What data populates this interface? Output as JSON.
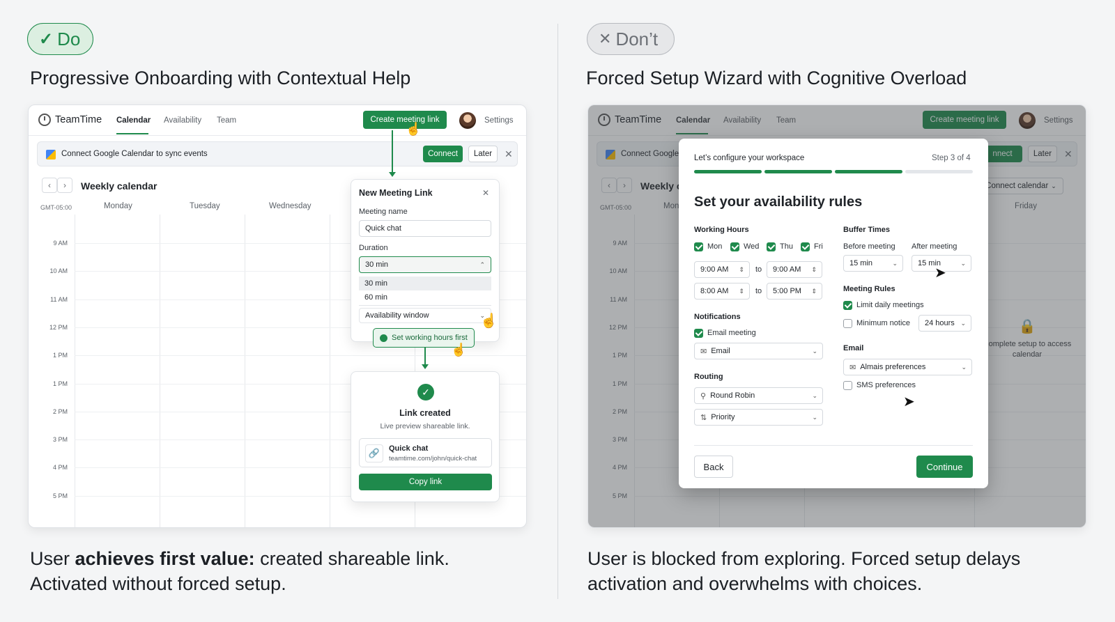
{
  "left": {
    "badge": "Do",
    "heading": "Progressive Onboarding with Contextual Help",
    "caption_bold": "achieves first value:",
    "caption_pre": "User ",
    "caption_post": " created shareable link.",
    "caption_line2": "Activated without forced setup.",
    "app": {
      "brand": "TeamTime",
      "nav": [
        "Calendar",
        "Availability",
        "Team"
      ],
      "create_button": "Create meeting link",
      "settings": "Settings",
      "banner": {
        "text": "Connect Google Calendar to sync events",
        "connect": "Connect",
        "later": "Later",
        "close": "✕"
      },
      "week_title": "Weekly calendar",
      "prev": "‹",
      "next": "›",
      "timezone": "GMT-05:00",
      "days": [
        "Monday",
        "Tuesday",
        "Wednesday"
      ],
      "times": [
        "9 AM",
        "10 AM",
        "11 AM",
        "12 PM",
        "1 PM",
        "1 PM",
        "2 PM",
        "3 PM",
        "4 PM",
        "5 PM"
      ]
    },
    "new_link_modal": {
      "title": "New Meeting Link",
      "close": "✕",
      "name_label": "Meeting name",
      "name_value": "Quick chat",
      "duration_label": "Duration",
      "duration_value": "30 min",
      "options": [
        "30 min",
        "60 min"
      ],
      "availability": "Availability window",
      "tooltip": "Set working hours first"
    },
    "created_card": {
      "title": "Link created",
      "subtitle": "Live preview shareable link.",
      "link_name": "Quick chat",
      "link_url": "teamtime.com/john/quick-chat",
      "copy": "Copy link"
    },
    "colors": {
      "accent": "#1f8a4c"
    }
  },
  "right": {
    "badge": "Don’t",
    "heading": "Forced Setup Wizard with Cognitive Overload",
    "caption_line1": "User is blocked from exploring. Forced setup delays",
    "caption_line2": "activation and overwhelms with choices.",
    "app": {
      "brand": "TeamTime",
      "nav": [
        "Calendar",
        "Availability",
        "Team"
      ],
      "create_button": "Create meeting link",
      "settings": "Settings",
      "banner_text": "Connect Google",
      "connect_partial": "nnect",
      "later": "Later",
      "close": "✕",
      "week_title": "Weekly c",
      "connect_calendar": "Connect calendar",
      "timezone": "GMT-05:00",
      "day_partial": "Mon",
      "friday": "Friday",
      "times": [
        "9 AM",
        "10 AM",
        "11 AM",
        "12 PM",
        "1 PM",
        "1 PM",
        "2 PM",
        "3 PM",
        "4 PM",
        "5 PM"
      ],
      "locked_text": "Complete setup to access calendar"
    },
    "wizard": {
      "header": "Let’s configure your workspace",
      "step": "Step 3 of 4",
      "progress_done": 3,
      "progress_total": 4,
      "title": "Set your availability rules",
      "working_hours": "Working Hours",
      "days": [
        "Mon",
        "Wed",
        "Thu",
        "Fri"
      ],
      "to": "to",
      "row1": [
        "9:00 AM",
        "9:00 AM"
      ],
      "row2": [
        "8:00 AM",
        "5:00 PM"
      ],
      "notifications": "Notifications",
      "email_meeting": "Email meeting",
      "email_select": "Email",
      "routing": "Routing",
      "round_robin": "Round Robin",
      "priority": "Priority",
      "buffer_times": "Buffer Times",
      "before_meeting": "Before meeting",
      "after_meeting": "After meeting",
      "before_value": "15 min",
      "after_value": "15 min",
      "meeting_rules": "Meeting Rules",
      "limit_daily": "Limit daily meetings",
      "min_notice": "Minimum notice",
      "notice_value": "24 hours",
      "email": "Email",
      "email_pref": "Almais preferences",
      "sms_pref": "SMS preferences",
      "back": "Back",
      "continue": "Continue"
    }
  }
}
